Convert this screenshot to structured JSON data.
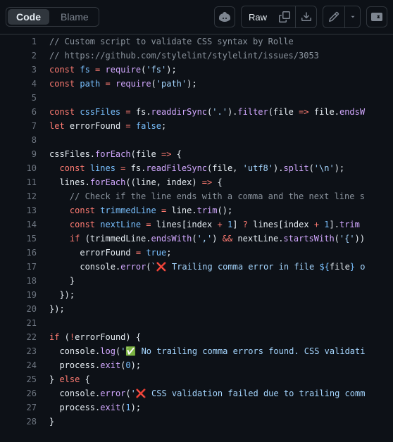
{
  "toolbar": {
    "code_label": "Code",
    "blame_label": "Blame",
    "raw_label": "Raw"
  },
  "lines": [
    {
      "n": 1,
      "indent": 0,
      "tokens": [
        [
          "c-cmt",
          "// Custom script to validate CSS syntax by Rolle"
        ]
      ]
    },
    {
      "n": 2,
      "indent": 0,
      "tokens": [
        [
          "c-cmt",
          "// https://github.com/stylelint/stylelint/issues/3053"
        ]
      ]
    },
    {
      "n": 3,
      "indent": 0,
      "tokens": [
        [
          "c-kw",
          "const"
        ],
        [
          "",
          " "
        ],
        [
          "c-prop",
          "fs"
        ],
        [
          "",
          " "
        ],
        [
          "c-kw",
          "="
        ],
        [
          "",
          " "
        ],
        [
          "c-fn",
          "require"
        ],
        [
          "",
          "("
        ],
        [
          "c-str",
          "'fs'"
        ],
        [
          "",
          ");"
        ]
      ]
    },
    {
      "n": 4,
      "indent": 0,
      "tokens": [
        [
          "c-kw",
          "const"
        ],
        [
          "",
          " "
        ],
        [
          "c-prop",
          "path"
        ],
        [
          "",
          " "
        ],
        [
          "c-kw",
          "="
        ],
        [
          "",
          " "
        ],
        [
          "c-fn",
          "require"
        ],
        [
          "",
          "("
        ],
        [
          "c-str",
          "'path'"
        ],
        [
          "",
          ");"
        ]
      ]
    },
    {
      "n": 5,
      "indent": 0,
      "tokens": []
    },
    {
      "n": 6,
      "indent": 0,
      "tokens": [
        [
          "c-kw",
          "const"
        ],
        [
          "",
          " "
        ],
        [
          "c-prop",
          "cssFiles"
        ],
        [
          "",
          " "
        ],
        [
          "c-kw",
          "="
        ],
        [
          "",
          " "
        ],
        [
          "c-var",
          "fs"
        ],
        [
          "",
          "."
        ],
        [
          "c-fn",
          "readdirSync"
        ],
        [
          "",
          "("
        ],
        [
          "c-str",
          "'.'"
        ],
        [
          "",
          ")."
        ],
        [
          "c-fn",
          "filter"
        ],
        [
          "",
          "("
        ],
        [
          "c-var",
          "file"
        ],
        [
          "",
          " "
        ],
        [
          "c-kw",
          "=>"
        ],
        [
          "",
          " "
        ],
        [
          "c-var",
          "file"
        ],
        [
          "",
          "."
        ],
        [
          "c-fn",
          "endsW"
        ]
      ]
    },
    {
      "n": 7,
      "indent": 0,
      "tokens": [
        [
          "c-kw",
          "let"
        ],
        [
          "",
          " "
        ],
        [
          "c-var",
          "errorFound"
        ],
        [
          "",
          " "
        ],
        [
          "c-kw",
          "="
        ],
        [
          "",
          " "
        ],
        [
          "c-bool",
          "false"
        ],
        [
          "",
          ";"
        ]
      ]
    },
    {
      "n": 8,
      "indent": 0,
      "tokens": []
    },
    {
      "n": 9,
      "indent": 0,
      "tokens": [
        [
          "c-var",
          "cssFiles"
        ],
        [
          "",
          "."
        ],
        [
          "c-fn",
          "forEach"
        ],
        [
          "",
          "("
        ],
        [
          "c-var",
          "file"
        ],
        [
          "",
          " "
        ],
        [
          "c-kw",
          "=>"
        ],
        [
          "",
          " {"
        ]
      ]
    },
    {
      "n": 10,
      "indent": 1,
      "tokens": [
        [
          "c-kw",
          "const"
        ],
        [
          "",
          " "
        ],
        [
          "c-prop",
          "lines"
        ],
        [
          "",
          " "
        ],
        [
          "c-kw",
          "="
        ],
        [
          "",
          " "
        ],
        [
          "c-var",
          "fs"
        ],
        [
          "",
          "."
        ],
        [
          "c-fn",
          "readFileSync"
        ],
        [
          "",
          "("
        ],
        [
          "c-var",
          "file"
        ],
        [
          "",
          ", "
        ],
        [
          "c-str",
          "'utf8'"
        ],
        [
          "",
          ")."
        ],
        [
          "c-fn",
          "split"
        ],
        [
          "",
          "("
        ],
        [
          "c-str",
          "'\\n'"
        ],
        [
          "",
          ");"
        ]
      ]
    },
    {
      "n": 11,
      "indent": 1,
      "tokens": [
        [
          "c-var",
          "lines"
        ],
        [
          "",
          "."
        ],
        [
          "c-fn",
          "forEach"
        ],
        [
          "",
          "(("
        ],
        [
          "c-var",
          "line"
        ],
        [
          "",
          ", "
        ],
        [
          "c-var",
          "index"
        ],
        [
          "",
          ") "
        ],
        [
          "c-kw",
          "=>"
        ],
        [
          "",
          " {"
        ]
      ]
    },
    {
      "n": 12,
      "indent": 2,
      "tokens": [
        [
          "c-cmt",
          "// Check if the line ends with a comma and the next line s"
        ]
      ]
    },
    {
      "n": 13,
      "indent": 2,
      "tokens": [
        [
          "c-kw",
          "const"
        ],
        [
          "",
          " "
        ],
        [
          "c-prop",
          "trimmedLine"
        ],
        [
          "",
          " "
        ],
        [
          "c-kw",
          "="
        ],
        [
          "",
          " "
        ],
        [
          "c-var",
          "line"
        ],
        [
          "",
          "."
        ],
        [
          "c-fn",
          "trim"
        ],
        [
          "",
          "();"
        ]
      ]
    },
    {
      "n": 14,
      "indent": 2,
      "tokens": [
        [
          "c-kw",
          "const"
        ],
        [
          "",
          " "
        ],
        [
          "c-prop",
          "nextLine"
        ],
        [
          "",
          " "
        ],
        [
          "c-kw",
          "="
        ],
        [
          "",
          " "
        ],
        [
          "c-var",
          "lines"
        ],
        [
          "",
          "["
        ],
        [
          "c-var",
          "index"
        ],
        [
          "",
          " "
        ],
        [
          "c-kw",
          "+"
        ],
        [
          "",
          " "
        ],
        [
          "c-num",
          "1"
        ],
        [
          "",
          "] "
        ],
        [
          "c-kw",
          "?"
        ],
        [
          "",
          " "
        ],
        [
          "c-var",
          "lines"
        ],
        [
          "",
          "["
        ],
        [
          "c-var",
          "index"
        ],
        [
          "",
          " "
        ],
        [
          "c-kw",
          "+"
        ],
        [
          "",
          " "
        ],
        [
          "c-num",
          "1"
        ],
        [
          "",
          "]."
        ],
        [
          "c-fn",
          "trim"
        ],
        [
          "",
          ""
        ]
      ]
    },
    {
      "n": 15,
      "indent": 2,
      "tokens": [
        [
          "c-kw",
          "if"
        ],
        [
          "",
          " ("
        ],
        [
          "c-var",
          "trimmedLine"
        ],
        [
          "",
          "."
        ],
        [
          "c-fn",
          "endsWith"
        ],
        [
          "",
          "("
        ],
        [
          "c-str",
          "','"
        ],
        [
          "",
          ") "
        ],
        [
          "c-kw",
          "&&"
        ],
        [
          "",
          " "
        ],
        [
          "c-var",
          "nextLine"
        ],
        [
          "",
          "."
        ],
        [
          "c-fn",
          "startsWith"
        ],
        [
          "",
          "("
        ],
        [
          "c-str",
          "'{'"
        ],
        [
          "",
          "))"
        ]
      ]
    },
    {
      "n": 16,
      "indent": 3,
      "tokens": [
        [
          "c-var",
          "errorFound"
        ],
        [
          "",
          " "
        ],
        [
          "c-kw",
          "="
        ],
        [
          "",
          " "
        ],
        [
          "c-bool",
          "true"
        ],
        [
          "",
          ";"
        ]
      ]
    },
    {
      "n": 17,
      "indent": 3,
      "tokens": [
        [
          "c-var",
          "console"
        ],
        [
          "",
          "."
        ],
        [
          "c-fn",
          "error"
        ],
        [
          "",
          "("
        ],
        [
          "c-str",
          "`❌ Trailing comma error in file "
        ],
        [
          "c-bool",
          "${"
        ],
        [
          "c-var",
          "file"
        ],
        [
          "c-bool",
          "}"
        ],
        [
          "c-str",
          " o"
        ]
      ]
    },
    {
      "n": 18,
      "indent": 2,
      "tokens": [
        [
          "",
          "}"
        ]
      ]
    },
    {
      "n": 19,
      "indent": 1,
      "tokens": [
        [
          "",
          "});"
        ]
      ]
    },
    {
      "n": 20,
      "indent": 0,
      "tokens": [
        [
          "",
          "});"
        ]
      ]
    },
    {
      "n": 21,
      "indent": 0,
      "tokens": []
    },
    {
      "n": 22,
      "indent": 0,
      "tokens": [
        [
          "c-kw",
          "if"
        ],
        [
          "",
          " ("
        ],
        [
          "c-kw",
          "!"
        ],
        [
          "c-var",
          "errorFound"
        ],
        [
          "",
          ") {"
        ]
      ]
    },
    {
      "n": 23,
      "indent": 1,
      "tokens": [
        [
          "c-var",
          "console"
        ],
        [
          "",
          "."
        ],
        [
          "c-fn",
          "log"
        ],
        [
          "",
          "("
        ],
        [
          "c-str",
          "'✅ No trailing comma errors found. CSS validati"
        ]
      ]
    },
    {
      "n": 24,
      "indent": 1,
      "tokens": [
        [
          "c-var",
          "process"
        ],
        [
          "",
          "."
        ],
        [
          "c-fn",
          "exit"
        ],
        [
          "",
          "("
        ],
        [
          "c-num",
          "0"
        ],
        [
          "",
          ");"
        ]
      ]
    },
    {
      "n": 25,
      "indent": 0,
      "tokens": [
        [
          "",
          "} "
        ],
        [
          "c-kw",
          "else"
        ],
        [
          "",
          " {"
        ]
      ]
    },
    {
      "n": 26,
      "indent": 1,
      "tokens": [
        [
          "c-var",
          "console"
        ],
        [
          "",
          "."
        ],
        [
          "c-fn",
          "error"
        ],
        [
          "",
          "("
        ],
        [
          "c-str",
          "'❌ CSS validation failed due to trailing comm"
        ]
      ]
    },
    {
      "n": 27,
      "indent": 1,
      "tokens": [
        [
          "c-var",
          "process"
        ],
        [
          "",
          "."
        ],
        [
          "c-fn",
          "exit"
        ],
        [
          "",
          "("
        ],
        [
          "c-num",
          "1"
        ],
        [
          "",
          ");"
        ]
      ]
    },
    {
      "n": 28,
      "indent": 0,
      "tokens": [
        [
          "",
          "}"
        ]
      ]
    }
  ]
}
